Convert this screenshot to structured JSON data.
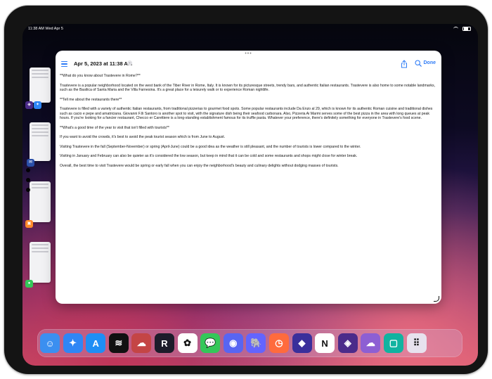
{
  "status_bar": {
    "time_date": "11:38 AM   Wed Apr 5",
    "battery": ""
  },
  "window": {
    "grabber": "•••",
    "title": "Apr 5, 2023 at 11:38 AM",
    "done_label": "Done"
  },
  "document": {
    "paragraphs": [
      "**What do you know about Trastevere in Rome?**",
      "Trastevere is a popular neighborhood located on the west bank of the Tiber River in Rome, Italy. It is known for its picturesque streets, trendy bars, and authentic Italian restaurants. Trastevere is also home to some notable landmarks, such as the Basilica of Santa Maria and the Villa Farnesina. It's a great place for a leisurely walk or to experience Roman nightlife.",
      "**Tell me about the restaurants there**",
      "Trastevere is filled with a variety of authentic Italian restaurants, from traditional pizzerias to gourmet food spots. Some popular restaurants include Da Enzo al 29, which is known for its authentic Roman cuisine and traditional dishes such as cacio e pepe and amatriciana. Giovanni F.lli Santoro is another spot to visit, with the signature dish being their seafood carbonara. Also, Pizzeria Ai Marmi serves some of the best pizza in the area with long queues at peak hours. If you're looking for a fancier restaurant, Checco er Carettiere is a long-standing establishment famous for its truffle pasta. Whatever your preference, there's definitely something for everyone in Trastevere's food scene.",
      "**What's a good time of the year to visit that isn't filled with tourists**",
      "If you want to avoid the crowds, it's best to avoid the peak tourist season which is from June to August.",
      "Visiting Trastevere in the fall (September-November) or spring (April-June) could be a good idea as the weather is still pleasant, and the number of tourists is lower compared to the winter.",
      "Visiting in January and February can also be quieter as it's considered the low season, but keep in mind that it can be cold and some restaurants and shops might close for winter break.",
      "Overall, the best time to visit Trastevere would be spring or early fall when you can enjoy the neighborhood's beauty and culinary delights without dodging masses of tourists."
    ]
  },
  "dock": {
    "apps": [
      {
        "name": "finder-icon",
        "bg": "#3b8ff0",
        "glyph": "☺"
      },
      {
        "name": "safari-icon",
        "bg": "#2f86f5",
        "glyph": "✦"
      },
      {
        "name": "app-store-icon",
        "bg": "#1e8ef5",
        "glyph": "A"
      },
      {
        "name": "spotify-icon",
        "bg": "#111111",
        "glyph": "≋"
      },
      {
        "name": "cloud-star-app-icon",
        "bg": "#c44545",
        "glyph": "☁"
      },
      {
        "name": "reeder-icon",
        "bg": "#1c1c2a",
        "glyph": "R"
      },
      {
        "name": "photos-icon",
        "bg": "#ffffff",
        "glyph": "✿"
      },
      {
        "name": "messages-icon",
        "bg": "#34c759",
        "glyph": "💬"
      },
      {
        "name": "discord-icon",
        "bg": "#5865f2",
        "glyph": "◉"
      },
      {
        "name": "mastodon-elephant-icon",
        "bg": "#6364ff",
        "glyph": "🐘"
      },
      {
        "name": "timer-icon",
        "bg": "#ff6b3d",
        "glyph": "◷"
      },
      {
        "name": "shortcuts-icon",
        "bg": "#3a2f9b",
        "glyph": "◆"
      },
      {
        "name": "notion-icon",
        "bg": "#ffffff",
        "glyph": "N"
      },
      {
        "name": "obsidian-icon",
        "bg": "#4b2b8a",
        "glyph": "◈"
      },
      {
        "name": "brain-app-icon",
        "bg": "#8d5fd3",
        "glyph": "☁"
      },
      {
        "name": "green-app-icon",
        "bg": "#12b3a0",
        "glyph": "▢"
      },
      {
        "name": "app-library-icon",
        "bg": "#e7e2ee",
        "glyph": "⠿"
      }
    ]
  },
  "colors": {
    "accent": "#2f7cf6"
  }
}
